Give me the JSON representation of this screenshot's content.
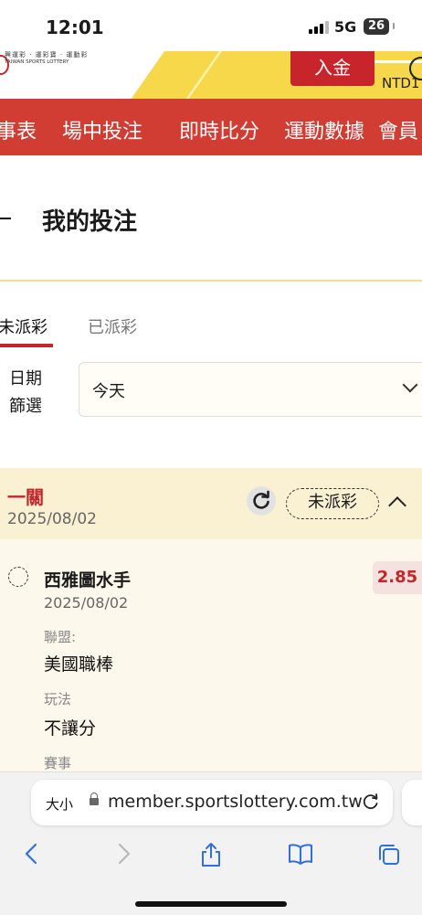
{
  "status_bar": {
    "time": "12:01",
    "network": "5G",
    "battery": "26"
  },
  "header": {
    "logo_line1": "興運彩 · 運彩寶 · 運動彩",
    "logo_line2": "TAIWAN SPORTS LOTTERY",
    "deposit_label": "入金",
    "balance_prefix": "NTD1"
  },
  "nav": {
    "items": [
      "事表",
      "場中投注",
      "即時比分",
      "運動數據",
      "會員"
    ]
  },
  "page": {
    "title": "我的投注"
  },
  "tabs": {
    "active": "未派彩",
    "inactive": "已派彩"
  },
  "filter": {
    "label": "日期篩選",
    "value": "今天"
  },
  "bet": {
    "type": "一關",
    "date": "2025/08/02",
    "status": "未派彩",
    "selection": {
      "team": "西雅圖水手",
      "date": "2025/08/02",
      "odds": "2.85",
      "league_label": "聯盟:",
      "league_value": "美國職棒",
      "play_label": "玩法",
      "play_value": "不讓分",
      "event_label": "賽事"
    }
  },
  "browser": {
    "text_size": "大小",
    "url": "member.sportslottery.com.tw"
  },
  "colors": {
    "brand_red": "#d13c33",
    "card_bg": "#faf0d2",
    "accent_yellow": "#f7d84a"
  }
}
